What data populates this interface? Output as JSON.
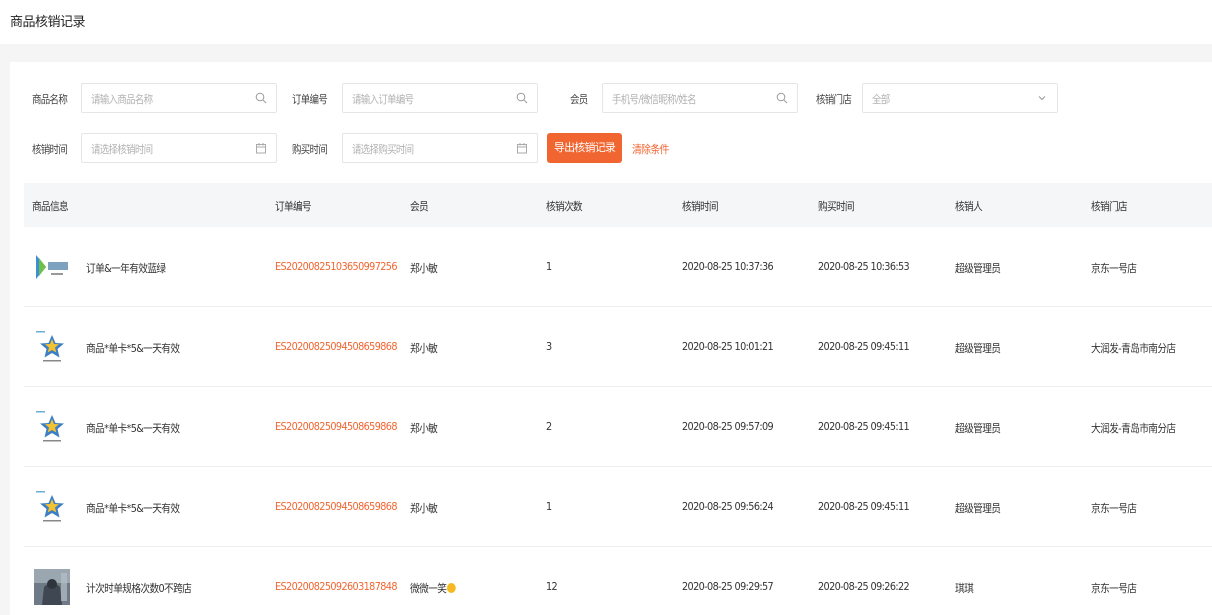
{
  "page": {
    "title": "商品核销记录"
  },
  "filters": {
    "product_name": {
      "label": "商品名称",
      "placeholder": "请输入商品名称"
    },
    "order_no": {
      "label": "订单编号",
      "placeholder": "请输入订单编号"
    },
    "member": {
      "label": "会员",
      "placeholder": "手机号/微信昵称/姓名"
    },
    "store": {
      "label": "核销门店",
      "value": "全部"
    },
    "verify_time": {
      "label": "核销时间",
      "placeholder": "请选择核销时间"
    },
    "purchase_time": {
      "label": "购买时间",
      "placeholder": "请选择购买时间"
    },
    "export_label": "导出核销记录",
    "clear_label": "清除条件"
  },
  "table": {
    "columns": [
      "商品信息",
      "订单编号",
      "会员",
      "核销次数",
      "核销时间",
      "购买时间",
      "核销人",
      "核销门店"
    ],
    "rows": [
      {
        "thumb": "logo-thumb",
        "product": "订单&一年有效蓝绿",
        "order_no": "ES20200825103650997256",
        "member": "郑小敏",
        "count": "1",
        "verify_time": "2020-08-25 10:37:36",
        "purchase_time": "2020-08-25 10:36:53",
        "operator": "超级管理员",
        "store": "京东一号店"
      },
      {
        "thumb": "star-thumb",
        "product": "商品*单卡*5&一天有效",
        "order_no": "ES20200825094508659868",
        "member": "郑小敏",
        "count": "3",
        "verify_time": "2020-08-25 10:01:21",
        "purchase_time": "2020-08-25 09:45:11",
        "operator": "超级管理员",
        "store": "大润发-青岛市南分店"
      },
      {
        "thumb": "star-thumb",
        "product": "商品*单卡*5&一天有效",
        "order_no": "ES20200825094508659868",
        "member": "郑小敏",
        "count": "2",
        "verify_time": "2020-08-25 09:57:09",
        "purchase_time": "2020-08-25 09:45:11",
        "operator": "超级管理员",
        "store": "大润发-青岛市南分店"
      },
      {
        "thumb": "star-thumb",
        "product": "商品*单卡*5&一天有效",
        "order_no": "ES20200825094508659868",
        "member": "郑小敏",
        "count": "1",
        "verify_time": "2020-08-25 09:56:24",
        "purchase_time": "2020-08-25 09:45:11",
        "operator": "超级管理员",
        "store": "京东一号店"
      },
      {
        "thumb": "photo-thumb",
        "product": "计次时单规格次数0不跨店",
        "order_no": "ES20200825092603187848",
        "member": "微微一笑",
        "member_emoji": true,
        "count": "12",
        "verify_time": "2020-08-25 09:29:57",
        "purchase_time": "2020-08-25 09:26:22",
        "operator": "琪琪",
        "store": "京东一号店"
      }
    ]
  },
  "colors": {
    "accent": "#f06530",
    "header_bg": "#f5f6f7",
    "page_bg": "#f5f5f5"
  }
}
